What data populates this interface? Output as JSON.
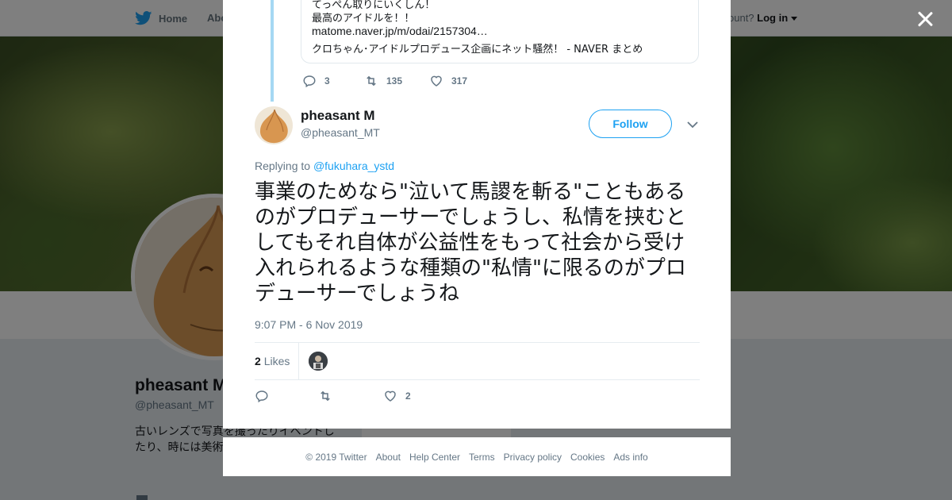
{
  "background": {
    "nav": {
      "home_label": "Home",
      "about_label": "Abo",
      "account_prompt": "ccount?",
      "login_label": "Log in"
    },
    "profile": {
      "name": "pheasant M",
      "handle": "@pheasant_MT",
      "bio": "古いレンズで写真を撮ったりイベントしたり、時には美術たり。（知性に欠り）"
    }
  },
  "parent_tweet": {
    "quote_lines": [
      "てっぺん取りにいくしん！",
      "最高のアイドルを！！",
      "matome.naver.jp/m/odai/2157304…",
      "クロちゃん･アイドルプロデュース企画にネット騒然！ - NAVER まとめ"
    ],
    "replies": "3",
    "retweets": "135",
    "likes": "317"
  },
  "tweet": {
    "name": "pheasant M",
    "handle": "@pheasant_MT",
    "follow_label": "Follow",
    "replying_to_label": "Replying to",
    "replying_to_handle": "@fukuhara_ystd",
    "text": "事業のためなら\"泣いて馬謖を斬る\"こともあるのがプロデューサーでしょうし、私情を挟むとしてもそれ自体が公益性をもって社会から受け入れられるような種類の\"私情\"に限るのがプロデューサーでしょうね",
    "timestamp": "9:07 PM - 6 Nov 2019",
    "likes_count": "2",
    "likes_label": "Likes",
    "action_likes": "2"
  },
  "footer": {
    "links": [
      "© 2019 Twitter",
      "About",
      "Help Center",
      "Terms",
      "Privacy policy",
      "Cookies",
      "Ads info"
    ]
  },
  "colors": {
    "accent": "#1da1f2",
    "thread_line": "#a5d8f3",
    "text": "#14171a",
    "muted": "#657786"
  },
  "icons": [
    "twitter-bird-icon",
    "close-icon",
    "reply-icon",
    "retweet-icon",
    "like-icon",
    "chevron-down-icon",
    "caret-down-icon"
  ]
}
